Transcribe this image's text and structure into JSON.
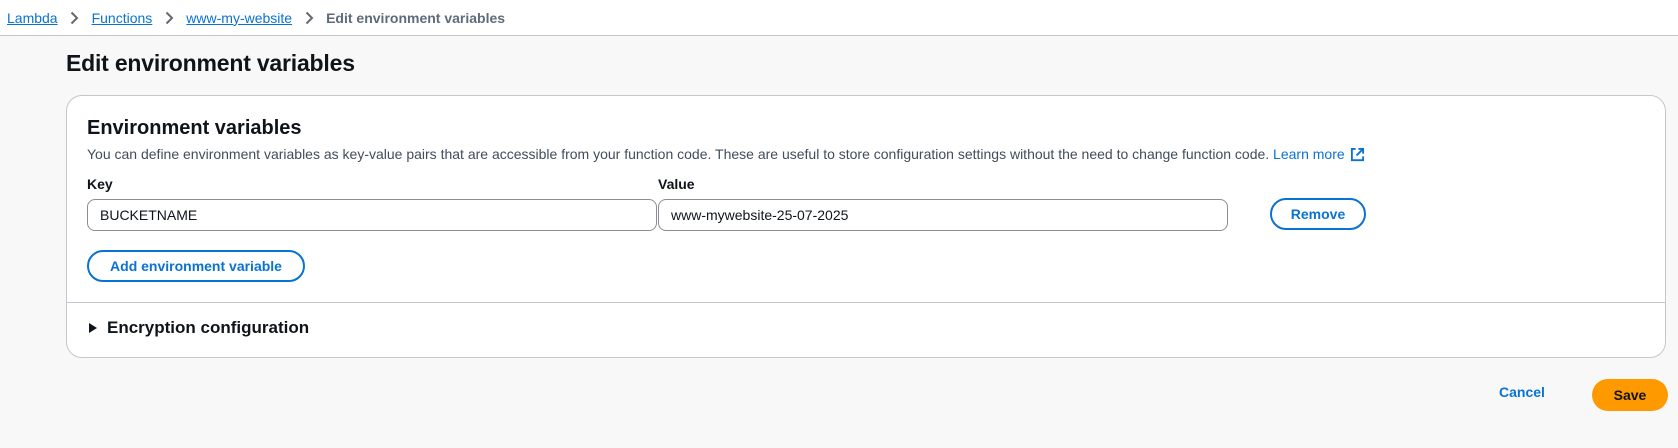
{
  "breadcrumb": {
    "items": [
      "Lambda",
      "Functions",
      "www-my-website"
    ],
    "current": "Edit environment variables"
  },
  "page": {
    "title": "Edit environment variables"
  },
  "panel": {
    "title": "Environment variables",
    "description": "You can define environment variables as key-value pairs that are accessible from your function code. These are useful to store configuration settings without the need to change function code.",
    "learn_more": "Learn more",
    "key_label": "Key",
    "value_label": "Value",
    "variables": [
      {
        "key": "BUCKETNAME",
        "value": "www-mywebsite-25-07-2025"
      }
    ],
    "remove_label": "Remove",
    "add_label": "Add environment variable",
    "encryption_label": "Encryption configuration"
  },
  "footer": {
    "cancel_label": "Cancel",
    "save_label": "Save"
  },
  "colors": {
    "link": "#0972d3",
    "primary": "#ff9900",
    "border": "#c6c6cd"
  },
  "icons": [
    "chevron-right-icon",
    "external-link-icon",
    "caret-right-icon"
  ]
}
